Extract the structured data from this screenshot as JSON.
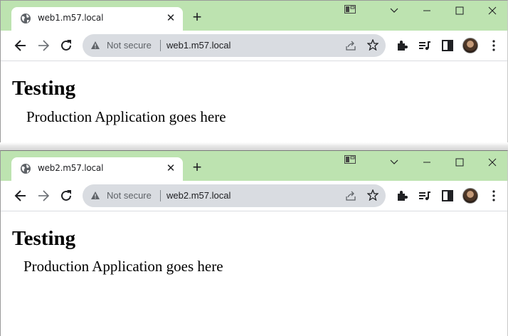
{
  "windows": [
    {
      "tab_title": "web1.m57.local",
      "security_label": "Not secure",
      "url": "web1.m57.local",
      "heading": "Testing",
      "body_text": "Production Application goes here"
    },
    {
      "tab_title": "web2.m57.local",
      "security_label": "Not secure",
      "url": "web2.m57.local",
      "heading": "Testing",
      "body_text": "Production Application goes here"
    }
  ],
  "colors": {
    "tabstrip": "#bde3b0",
    "omnibox": "#d9dce1",
    "text": "#202124",
    "muted": "#5f6368"
  },
  "icons": [
    "globe-icon",
    "close-icon",
    "plus-icon",
    "tab-search-icon",
    "chevron-down-icon",
    "minimize-icon",
    "maximize-icon",
    "window-close-icon",
    "back-arrow-icon",
    "forward-arrow-icon",
    "reload-icon",
    "warning-icon",
    "share-icon",
    "star-icon",
    "extensions-puzzle-icon",
    "media-queue-icon",
    "side-panel-icon",
    "profile-avatar",
    "kebab-menu-icon"
  ]
}
